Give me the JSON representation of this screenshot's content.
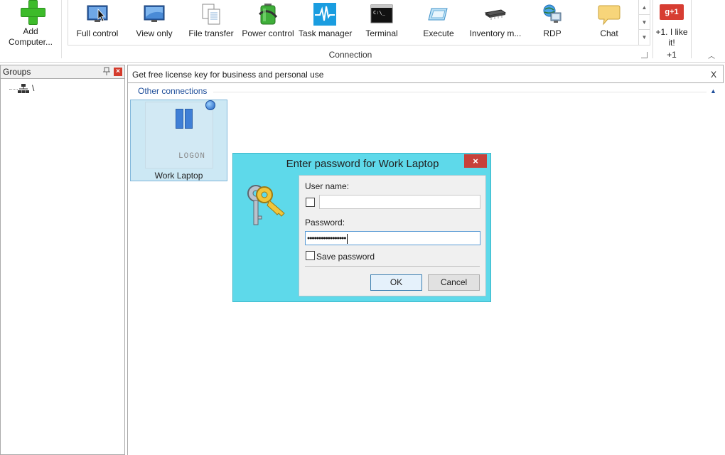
{
  "ribbon": {
    "add_computer": {
      "label": "Add Computer...",
      "icon": "plus-icon"
    },
    "connection_group_label": "Connection",
    "buttons": [
      {
        "label": "Full control",
        "icon": "monitor-icon"
      },
      {
        "label": "View only",
        "icon": "monitor-view-icon"
      },
      {
        "label": "File transfer",
        "icon": "files-icon"
      },
      {
        "label": "Power control",
        "icon": "battery-icon"
      },
      {
        "label": "Task manager",
        "icon": "pulse-icon"
      },
      {
        "label": "Terminal",
        "icon": "terminal-icon"
      },
      {
        "label": "Execute",
        "icon": "execute-icon"
      },
      {
        "label": "Inventory m...",
        "icon": "chip-icon"
      },
      {
        "label": "RDP",
        "icon": "rdp-icon"
      },
      {
        "label": "Chat",
        "icon": "chat-bubble-icon"
      }
    ],
    "gplus": {
      "badge": "g+1",
      "label": "+1. I like it!",
      "group_label": "+1"
    }
  },
  "groups_panel": {
    "title": "Groups",
    "close": "×",
    "tree_root": "\\"
  },
  "main": {
    "license_text": "Get free license key for business and personal use",
    "license_close": "X",
    "section_title": "Other connections",
    "tile": {
      "name": "Work Laptop",
      "status": "LOGON"
    }
  },
  "dialog": {
    "title": "Enter password for Work Laptop",
    "close": "×",
    "username_label": "User name:",
    "username_value": "",
    "password_label": "Password:",
    "password_value": "•••••••••••••••••",
    "save_password_label": "Save password",
    "ok_label": "OK",
    "cancel_label": "Cancel"
  },
  "colors": {
    "dialog_bg": "#5ed9ea",
    "tile_bg": "#cce8f4",
    "accent_blue": "#1e4e9a",
    "close_red": "#c7413a"
  }
}
